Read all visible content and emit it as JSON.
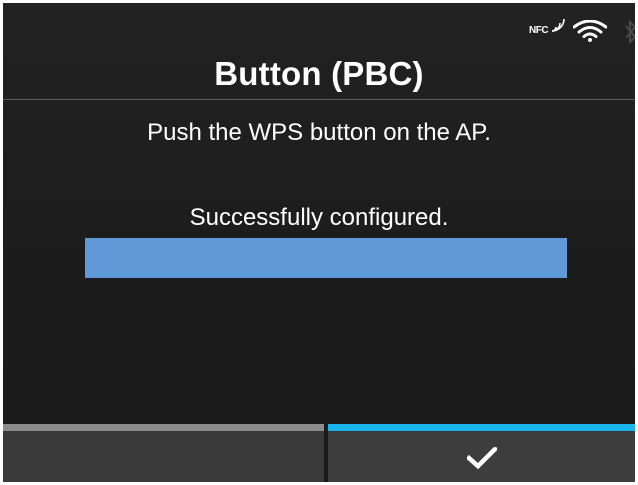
{
  "status_icons": {
    "nfc_label": "NFC",
    "nfc": "nfc-icon",
    "wifi": "wifi-icon",
    "bluetooth": "bluetooth-icon"
  },
  "screen": {
    "title": "Button (PBC)",
    "instruction": "Push the WPS button on the AP.",
    "status": "Successfully configured.",
    "progress_percent": 100
  },
  "softkeys": {
    "left": {
      "label": ""
    },
    "right": {
      "icon": "checkmark-icon"
    }
  },
  "colors": {
    "background": "#1d1d1d",
    "progress": "#6099d7",
    "left_softkey_bar": "#8c8c8c",
    "right_softkey_bar": "#19b5ec"
  }
}
